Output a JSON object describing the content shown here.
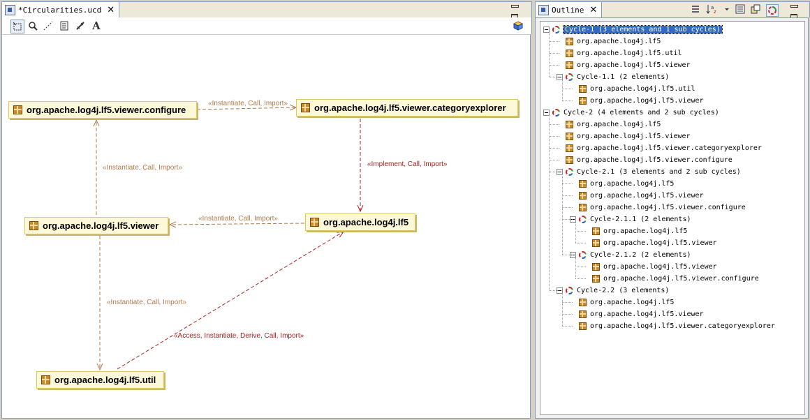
{
  "editor": {
    "tab_title": "*Circularities.ucd",
    "tab_icon": "diagram-file-icon",
    "toolbar": {
      "tools": [
        "select-tool-icon",
        "zoom-tool-icon",
        "dependency-tool-icon",
        "note-tool-icon",
        "link-tool-icon",
        "text-tool-icon"
      ],
      "right_icon": "package-cube-icon"
    },
    "nodes": {
      "configure": "org.apache.log4j.lf5.viewer.configure",
      "categoryexplorer": "org.apache.log4j.lf5.viewer.categoryexplorer",
      "viewer": "org.apache.log4j.lf5.viewer",
      "lf5": "org.apache.log4j.lf5",
      "util": "org.apache.log4j.lf5.util"
    },
    "edges": {
      "configure_to_categoryexplorer": "«Instantiate, Call, Import»",
      "categoryexplorer_to_lf5": "«Implement, Call, Import»",
      "viewer_to_configure": "«Instantiate, Call, Import»",
      "lf5_to_viewer": "«Instantiate, Call, Import»",
      "viewer_to_util": "«Instantiate, Call, Import»",
      "util_to_lf5": "«Access, Instantiate, Derive, Call, Import»"
    },
    "colors": {
      "edge_brown": "#b07a4a",
      "edge_red": "#b01c1c",
      "node_fill": "#fdf8d8"
    }
  },
  "outline": {
    "tab_title": "Outline",
    "tab_icon": "outline-icon",
    "toolbar_icons": [
      "list-view-icon",
      "sort-az-icon",
      "dropdown-icon",
      "flat-layout-icon",
      "hierarchical-layout-icon",
      "cycles-icon"
    ],
    "tree": [
      {
        "type": "cycle",
        "level": 0,
        "label": "Cycle-1  (3 elements and 1 sub cycles)",
        "selected": true
      },
      {
        "type": "pkg",
        "level": 1,
        "label": "org.apache.log4j.lf5"
      },
      {
        "type": "pkg",
        "level": 1,
        "label": "org.apache.log4j.lf5.util"
      },
      {
        "type": "pkg",
        "level": 1,
        "label": "org.apache.log4j.lf5.viewer"
      },
      {
        "type": "cycle",
        "level": 1,
        "label": "Cycle-1.1  (2 elements)"
      },
      {
        "type": "pkg",
        "level": 2,
        "label": "org.apache.log4j.lf5.util"
      },
      {
        "type": "pkg",
        "level": 2,
        "label": "org.apache.log4j.lf5.viewer"
      },
      {
        "type": "cycle",
        "level": 0,
        "label": "Cycle-2  (4 elements and 2 sub cycles)"
      },
      {
        "type": "pkg",
        "level": 1,
        "label": "org.apache.log4j.lf5"
      },
      {
        "type": "pkg",
        "level": 1,
        "label": "org.apache.log4j.lf5.viewer"
      },
      {
        "type": "pkg",
        "level": 1,
        "label": "org.apache.log4j.lf5.viewer.categoryexplorer"
      },
      {
        "type": "pkg",
        "level": 1,
        "label": "org.apache.log4j.lf5.viewer.configure"
      },
      {
        "type": "cycle",
        "level": 1,
        "label": "Cycle-2.1  (3 elements and 2 sub cycles)"
      },
      {
        "type": "pkg",
        "level": 2,
        "label": "org.apache.log4j.lf5"
      },
      {
        "type": "pkg",
        "level": 2,
        "label": "org.apache.log4j.lf5.viewer"
      },
      {
        "type": "pkg",
        "level": 2,
        "label": "org.apache.log4j.lf5.viewer.configure"
      },
      {
        "type": "cycle",
        "level": 2,
        "label": "Cycle-2.1.1  (2 elements)"
      },
      {
        "type": "pkg",
        "level": 3,
        "label": "org.apache.log4j.lf5"
      },
      {
        "type": "pkg",
        "level": 3,
        "label": "org.apache.log4j.lf5.viewer"
      },
      {
        "type": "cycle",
        "level": 2,
        "label": "Cycle-2.1.2  (2 elements)"
      },
      {
        "type": "pkg",
        "level": 3,
        "label": "org.apache.log4j.lf5.viewer"
      },
      {
        "type": "pkg",
        "level": 3,
        "label": "org.apache.log4j.lf5.viewer.configure"
      },
      {
        "type": "cycle",
        "level": 1,
        "label": "Cycle-2.2  (3 elements)"
      },
      {
        "type": "pkg",
        "level": 2,
        "label": "org.apache.log4j.lf5"
      },
      {
        "type": "pkg",
        "level": 2,
        "label": "org.apache.log4j.lf5.viewer"
      },
      {
        "type": "pkg",
        "level": 2,
        "label": "org.apache.log4j.lf5.viewer.categoryexplorer"
      }
    ]
  }
}
